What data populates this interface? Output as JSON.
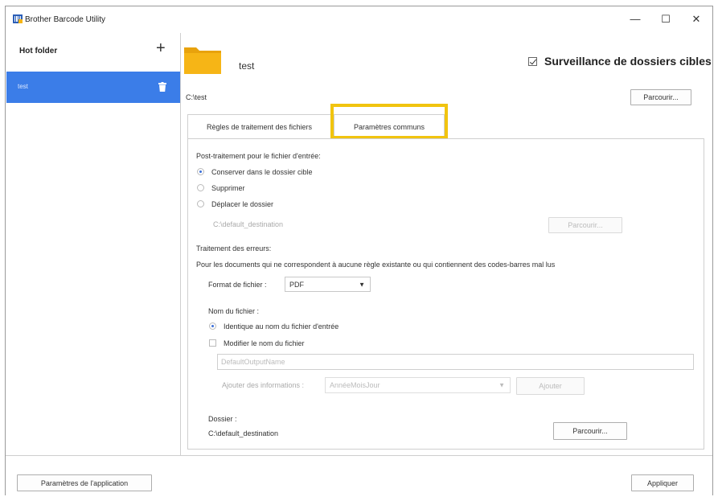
{
  "window": {
    "title": "Brother Barcode Utility",
    "controls": {
      "minimize": "—",
      "maximize": "☐",
      "close": "✕"
    }
  },
  "sidebar": {
    "header": "Hot folder",
    "add_label": "+",
    "items": [
      {
        "label": "test",
        "selected": true
      }
    ]
  },
  "header": {
    "folder_name": "test",
    "monitor_label": "Surveillance de dossiers cibles",
    "monitor_checked": true,
    "path": "C:\\test",
    "browse_label": "Parcourir..."
  },
  "tabs": [
    {
      "label": "Règles de traitement des fichiers",
      "active": false
    },
    {
      "label": "Paramètres communs",
      "active": true
    }
  ],
  "post_processing": {
    "title": "Post-traitement pour le fichier d'entrée:",
    "options": [
      {
        "label": "Conserver dans le dossier cible",
        "selected": true
      },
      {
        "label": "Supprimer",
        "selected": false
      },
      {
        "label": "Déplacer le dossier",
        "selected": false
      }
    ],
    "move_path": "C:\\default_destination",
    "browse_label": "Parcourir..."
  },
  "errors": {
    "title": "Traitement des erreurs:",
    "description": "Pour les documents qui ne correspondent à aucune règle existante ou qui contiennent des codes-barres mal lus",
    "format_label": "Format de fichier :",
    "format_value": "PDF",
    "filename_label": "Nom du fichier :",
    "filename_options": [
      {
        "label": "Identique au nom du fichier d'entrée",
        "selected": true
      },
      {
        "label": "Modifier le nom du fichier",
        "selected": false
      }
    ],
    "filename_placeholder": "DefaultOutputName",
    "add_info_label": "Ajouter des informations :",
    "add_info_value": "AnnéeMoisJour",
    "add_button": "Ajouter",
    "folder_label": "Dossier :",
    "folder_path": "C:\\default_destination",
    "folder_browse": "Parcourir..."
  },
  "footer": {
    "app_settings": "Paramètres de l'application",
    "apply": "Appliquer"
  },
  "colors": {
    "accent": "#3b7de8",
    "highlight_frame": "#f1c40f",
    "folder": "#f6b516"
  }
}
